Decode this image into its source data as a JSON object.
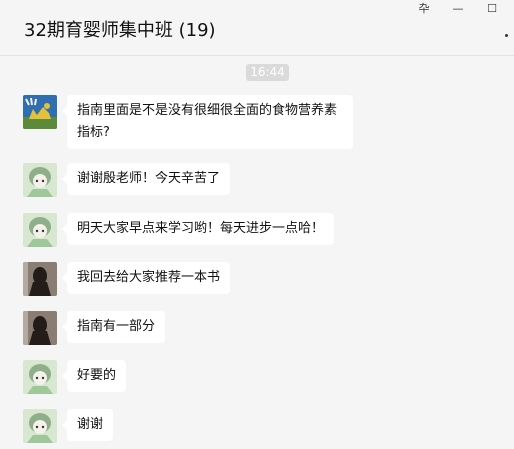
{
  "window": {
    "pin_glyph": "卆",
    "minimize_glyph": "—",
    "maximize_glyph": "☐",
    "more_icon": "more-icon"
  },
  "chat": {
    "title": "32期育婴师集中班 (19)",
    "time_divider": "16:44"
  },
  "messages": [
    {
      "avatar": "dinosaur-avatar",
      "text": "指南里面是不是没有很细很全面的食物营养素指标?"
    },
    {
      "avatar": "anime-girl-avatar",
      "text": "谢谢殷老师！今天辛苦了"
    },
    {
      "avatar": "anime-girl-avatar",
      "text": "明天大家早点来学习哟！每天进步一点哈！"
    },
    {
      "avatar": "dark-silhouette-avatar",
      "text": "我回去给大家推荐一本书"
    },
    {
      "avatar": "dark-silhouette-avatar",
      "text": "指南有一部分"
    },
    {
      "avatar": "anime-girl-avatar",
      "text": "好要的"
    },
    {
      "avatar": "anime-girl-avatar",
      "text": "谢谢"
    }
  ],
  "colors": {
    "background": "#f5f5f5",
    "bubble": "#ffffff",
    "time_badge": "#dadada"
  }
}
